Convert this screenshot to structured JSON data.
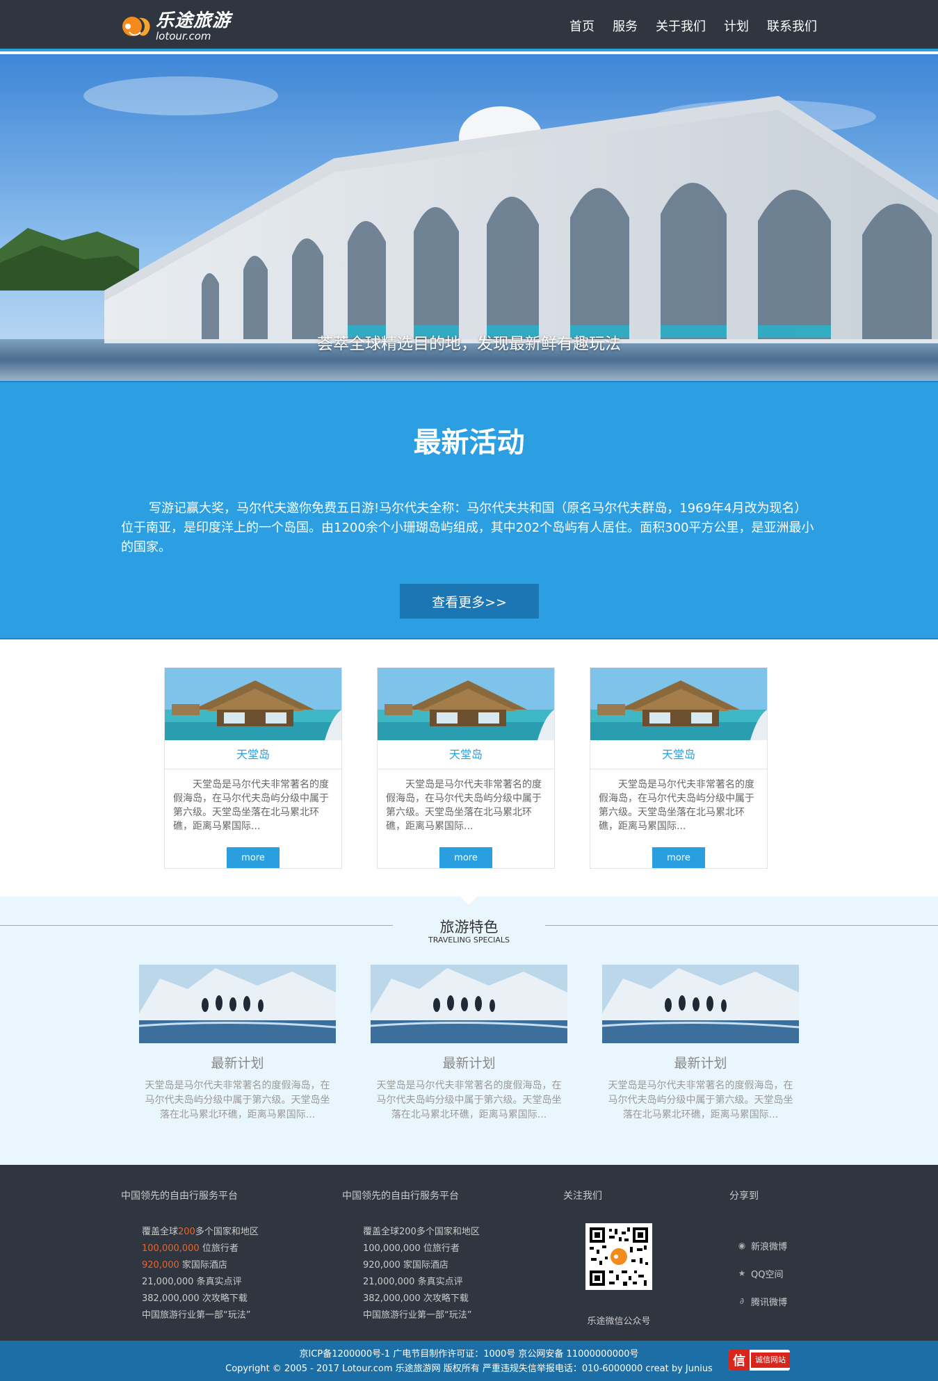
{
  "header": {
    "logo_cn": "乐途旅游",
    "logo_en": "lotour.com",
    "nav": [
      "首页",
      "服务",
      "关于我们",
      "计划",
      "联系我们"
    ]
  },
  "hero": {
    "caption": "荟萃全球精选目的地，发现最新鲜有趣玩法"
  },
  "activity": {
    "title": "最新活动",
    "text": "写游记赢大奖，马尔代夫邀你免费五日游!马尔代夫全称：马尔代夫共和国（原名马尔代夫群岛，1969年4月改为现名）位于南亚，是印度洋上的一个岛国。由1200余个小珊瑚岛屿组成，其中202个岛屿有人居住。面积300平方公里，是亚洲最小的国家。",
    "button": "查看更多>>"
  },
  "cards": [
    {
      "title": "天堂岛",
      "text": "天堂岛是马尔代夫非常著名的度假海岛，在马尔代夫岛屿分级中属于第六级。天堂岛坐落在北马累北环礁，距离马累国际...",
      "button": "more"
    },
    {
      "title": "天堂岛",
      "text": "天堂岛是马尔代夫非常著名的度假海岛，在马尔代夫岛屿分级中属于第六级。天堂岛坐落在北马累北环礁，距离马累国际...",
      "button": "more"
    },
    {
      "title": "天堂岛",
      "text": "天堂岛是马尔代夫非常著名的度假海岛，在马尔代夫岛屿分级中属于第六级。天堂岛坐落在北马累北环礁，距离马累国际...",
      "button": "more"
    }
  ],
  "specials": {
    "title": "旅游特色",
    "subtitle": "TRAVELING SPECIALS",
    "items": [
      {
        "title": "最新计划",
        "text": "天堂岛是马尔代夫非常著名的度假海岛，在马尔代夫岛屿分级中属于第六级。天堂岛坐落在北马累北环礁，距离马累国际..."
      },
      {
        "title": "最新计划",
        "text": "天堂岛是马尔代夫非常著名的度假海岛，在马尔代夫岛屿分级中属于第六级。天堂岛坐落在北马累北环礁，距离马累国际..."
      },
      {
        "title": "最新计划",
        "text": "天堂岛是马尔代夫非常著名的度假海岛，在马尔代夫岛屿分级中属于第六级。天堂岛坐落在北马累北环礁，距离马累国际..."
      }
    ]
  },
  "footer": {
    "col1": {
      "title": "中国领先的自由行服务平台",
      "l1_pre": "覆盖全球",
      "l1_hl": "200",
      "l1_post": "多个国家和地区",
      "l2_hl": "100,000,000",
      "l2_post": " 位旅行者",
      "l3_hl": "920,000",
      "l3_post": " 家国际酒店",
      "l4": "21,000,000 条真实点评",
      "l5": "382,000,000 次攻略下载",
      "l6": "中国旅游行业第一部“玩法”"
    },
    "col2": {
      "title": "中国领先的自由行服务平台",
      "items": [
        "覆盖全球200多个国家和地区",
        "100,000,000 位旅行者",
        "920,000 家国际酒店",
        "21,000,000 条真实点评",
        "382,000,000 次攻略下载",
        "中国旅游行业第一部“玩法”"
      ]
    },
    "follow": {
      "title": "关注我们",
      "caption": "乐途微信公众号"
    },
    "share": {
      "title": "分享到",
      "items": [
        "新浪微博",
        "QQ空间",
        "腾讯微博"
      ]
    },
    "bottom_line1": "京ICP备1200000号-1 广电节目制作许可证：1000号 京公网安备 11000000000号",
    "bottom_line2": "Copyright © 2005 - 2017 Lotour.com 乐途旅游网 版权所有 严重违规失信举报电话：010-6000000 creat by Junius",
    "badge_mark": "信",
    "badge_text": "诚信网站"
  },
  "colors": {
    "header_bg": "#2f3640",
    "accent_blue": "#2b9fe1",
    "button_dark_blue": "#1b76b3",
    "highlight_orange": "#e8662c",
    "specials_bg": "#eaf6fd",
    "bottom_bar": "#1c6fa6"
  }
}
